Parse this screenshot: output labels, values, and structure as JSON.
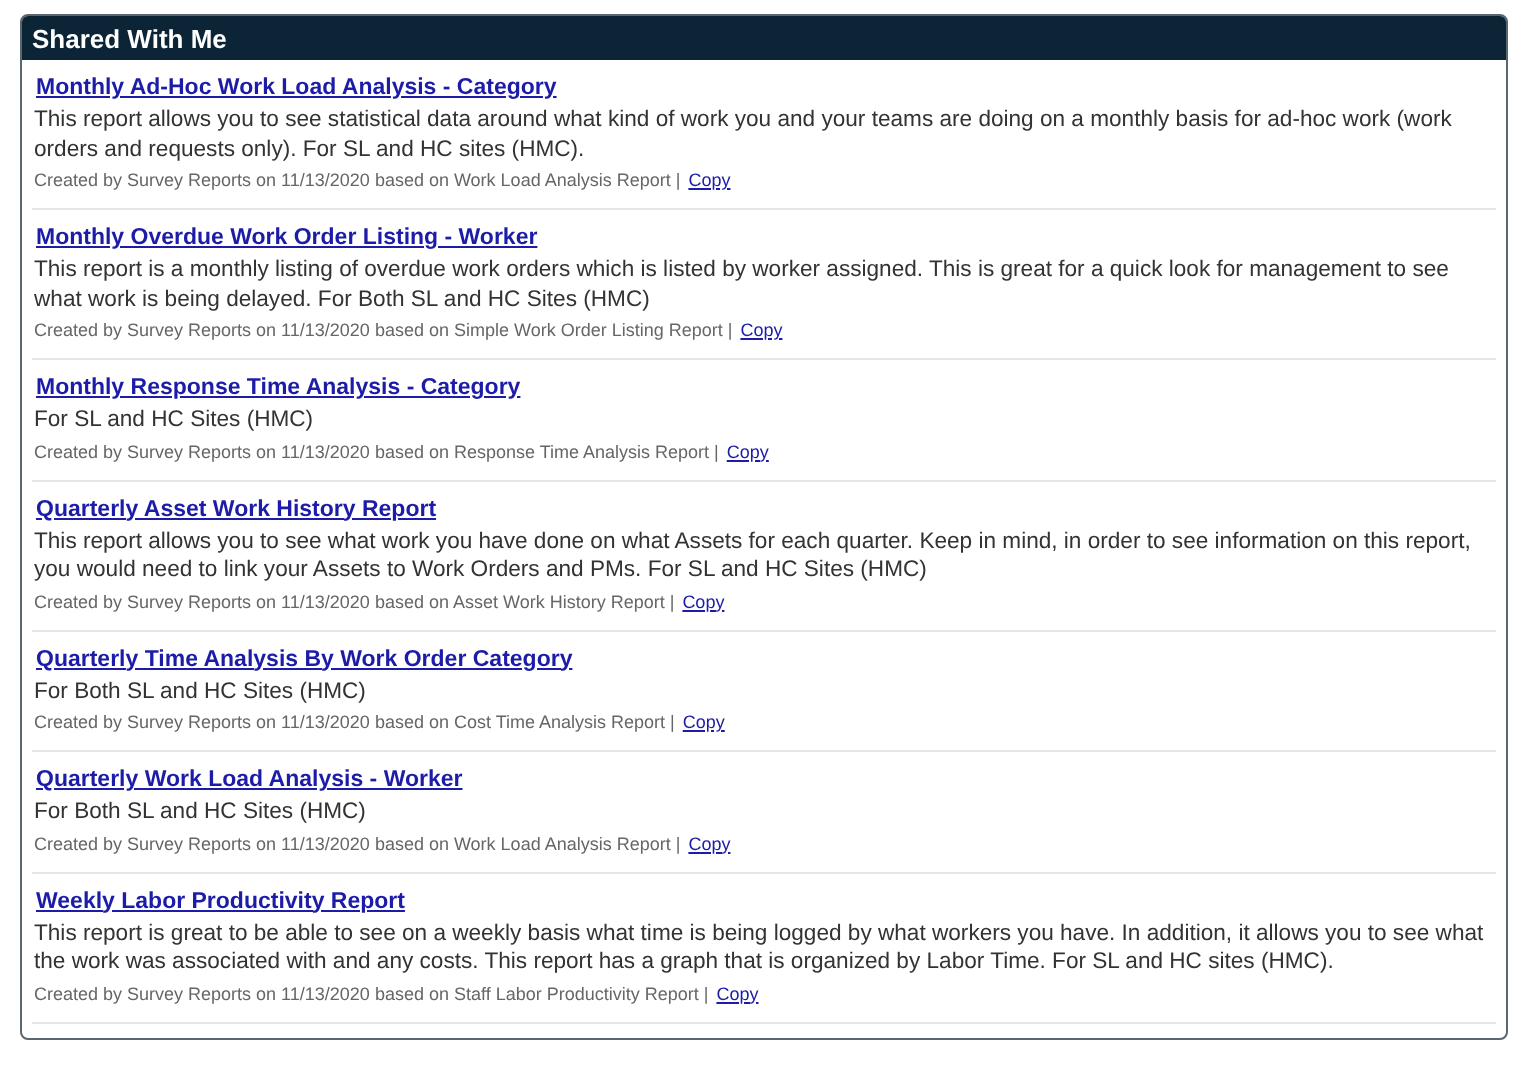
{
  "panel": {
    "title": "Shared With Me"
  },
  "reports": [
    {
      "title": "Monthly Ad-Hoc Work Load Analysis - Category",
      "description": "This report allows you to see statistical data around what kind of work you and your teams are doing on a monthly basis for ad-hoc work (work orders and requests only). For SL and HC sites (HMC).",
      "meta": "Created by Survey Reports on 11/13/2020 based on Work Load Analysis Report |",
      "action": "Copy"
    },
    {
      "title": "Monthly Overdue Work Order Listing - Worker",
      "description": "This report is a monthly listing of overdue work orders which is listed by worker assigned. This is great for a quick look for management to see what work is being delayed. For Both SL and HC Sites (HMC)",
      "meta": "Created by Survey Reports on 11/13/2020 based on Simple Work Order Listing Report |",
      "action": "Copy"
    },
    {
      "title": "Monthly Response Time Analysis - Category",
      "description": "For SL and HC Sites (HMC)",
      "meta": "Created by Survey Reports on 11/13/2020 based on Response Time Analysis Report |",
      "action": "Copy"
    },
    {
      "title": "Quarterly Asset Work History Report",
      "description": "This report allows you to see what work you have done on what Assets for each quarter. Keep in mind, in order to see information on this report, you would need to link your Assets to Work Orders and PMs. For SL and HC Sites (HMC)",
      "meta": "Created by Survey Reports on 11/13/2020 based on Asset Work History Report |",
      "action": "Copy"
    },
    {
      "title": "Quarterly Time Analysis By Work Order Category",
      "description": "For Both SL and HC Sites (HMC)",
      "meta": "Created by Survey Reports on 11/13/2020 based on Cost Time Analysis Report |",
      "action": "Copy"
    },
    {
      "title": "Quarterly Work Load Analysis - Worker",
      "description": "For Both SL and HC Sites (HMC)",
      "meta": "Created by Survey Reports on 11/13/2020 based on Work Load Analysis Report |",
      "action": "Copy"
    },
    {
      "title": "Weekly Labor Productivity Report",
      "description": "This report is great to be able to see on a weekly basis what time is being logged by what workers you have. In addition, it allows you to see what the work was associated with and any costs. This report has a graph that is organized by Labor Time. For SL and HC sites (HMC).",
      "meta": "Created by Survey Reports on 11/13/2020 based on Staff Labor Productivity Report |",
      "action": "Copy"
    }
  ]
}
